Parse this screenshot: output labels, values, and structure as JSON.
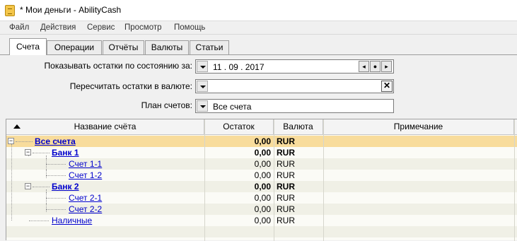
{
  "window": {
    "title": "* Мои деньги - AbilityCash"
  },
  "menu": [
    "Файл",
    "Действия",
    "Сервис",
    "Просмотр",
    "Помощь"
  ],
  "tabs": [
    "Счета",
    "Операции",
    "Отчёты",
    "Валюты",
    "Статьи"
  ],
  "form": {
    "balance_date_label": "Показывать остатки по состоянию за:",
    "balance_date_value": "11 . 09 . 2017",
    "recalc_currency_label": "Пересчитать остатки в валюте:",
    "recalc_currency_value": "",
    "chart_of_accounts_label": "План счетов:",
    "chart_of_accounts_value": "Все счета"
  },
  "grid": {
    "columns": [
      "Название счёта",
      "Остаток",
      "Валюта",
      "Примечание"
    ],
    "rows": [
      {
        "name": "Все счета",
        "balance": "0,00",
        "currency": "RUR",
        "note": ""
      },
      {
        "name": "Банк 1",
        "balance": "0,00",
        "currency": "RUR",
        "note": ""
      },
      {
        "name": "Счет 1-1",
        "balance": "0,00",
        "currency": "RUR",
        "note": ""
      },
      {
        "name": "Счет 1-2",
        "balance": "0,00",
        "currency": "RUR",
        "note": ""
      },
      {
        "name": "Банк 2",
        "balance": "0,00",
        "currency": "RUR",
        "note": ""
      },
      {
        "name": "Счет 2-1",
        "balance": "0,00",
        "currency": "RUR",
        "note": ""
      },
      {
        "name": "Счет 2-2",
        "balance": "0,00",
        "currency": "RUR",
        "note": ""
      },
      {
        "name": "Наличные",
        "balance": "0,00",
        "currency": "RUR",
        "note": ""
      }
    ]
  },
  "icons": {
    "app": "app-wallet-icon",
    "sort": "sort-ascending-icon",
    "dropdown": "dropdown-arrow-icon",
    "prev": "prev-date-icon",
    "today": "today-date-icon",
    "next": "next-date-icon",
    "clear": "clear-x-icon",
    "collapse": "tree-collapse-icon"
  },
  "colors": {
    "selected_row": "#f8dc9c",
    "alt_row": "#f0f0e6",
    "link": "#0000cc"
  }
}
